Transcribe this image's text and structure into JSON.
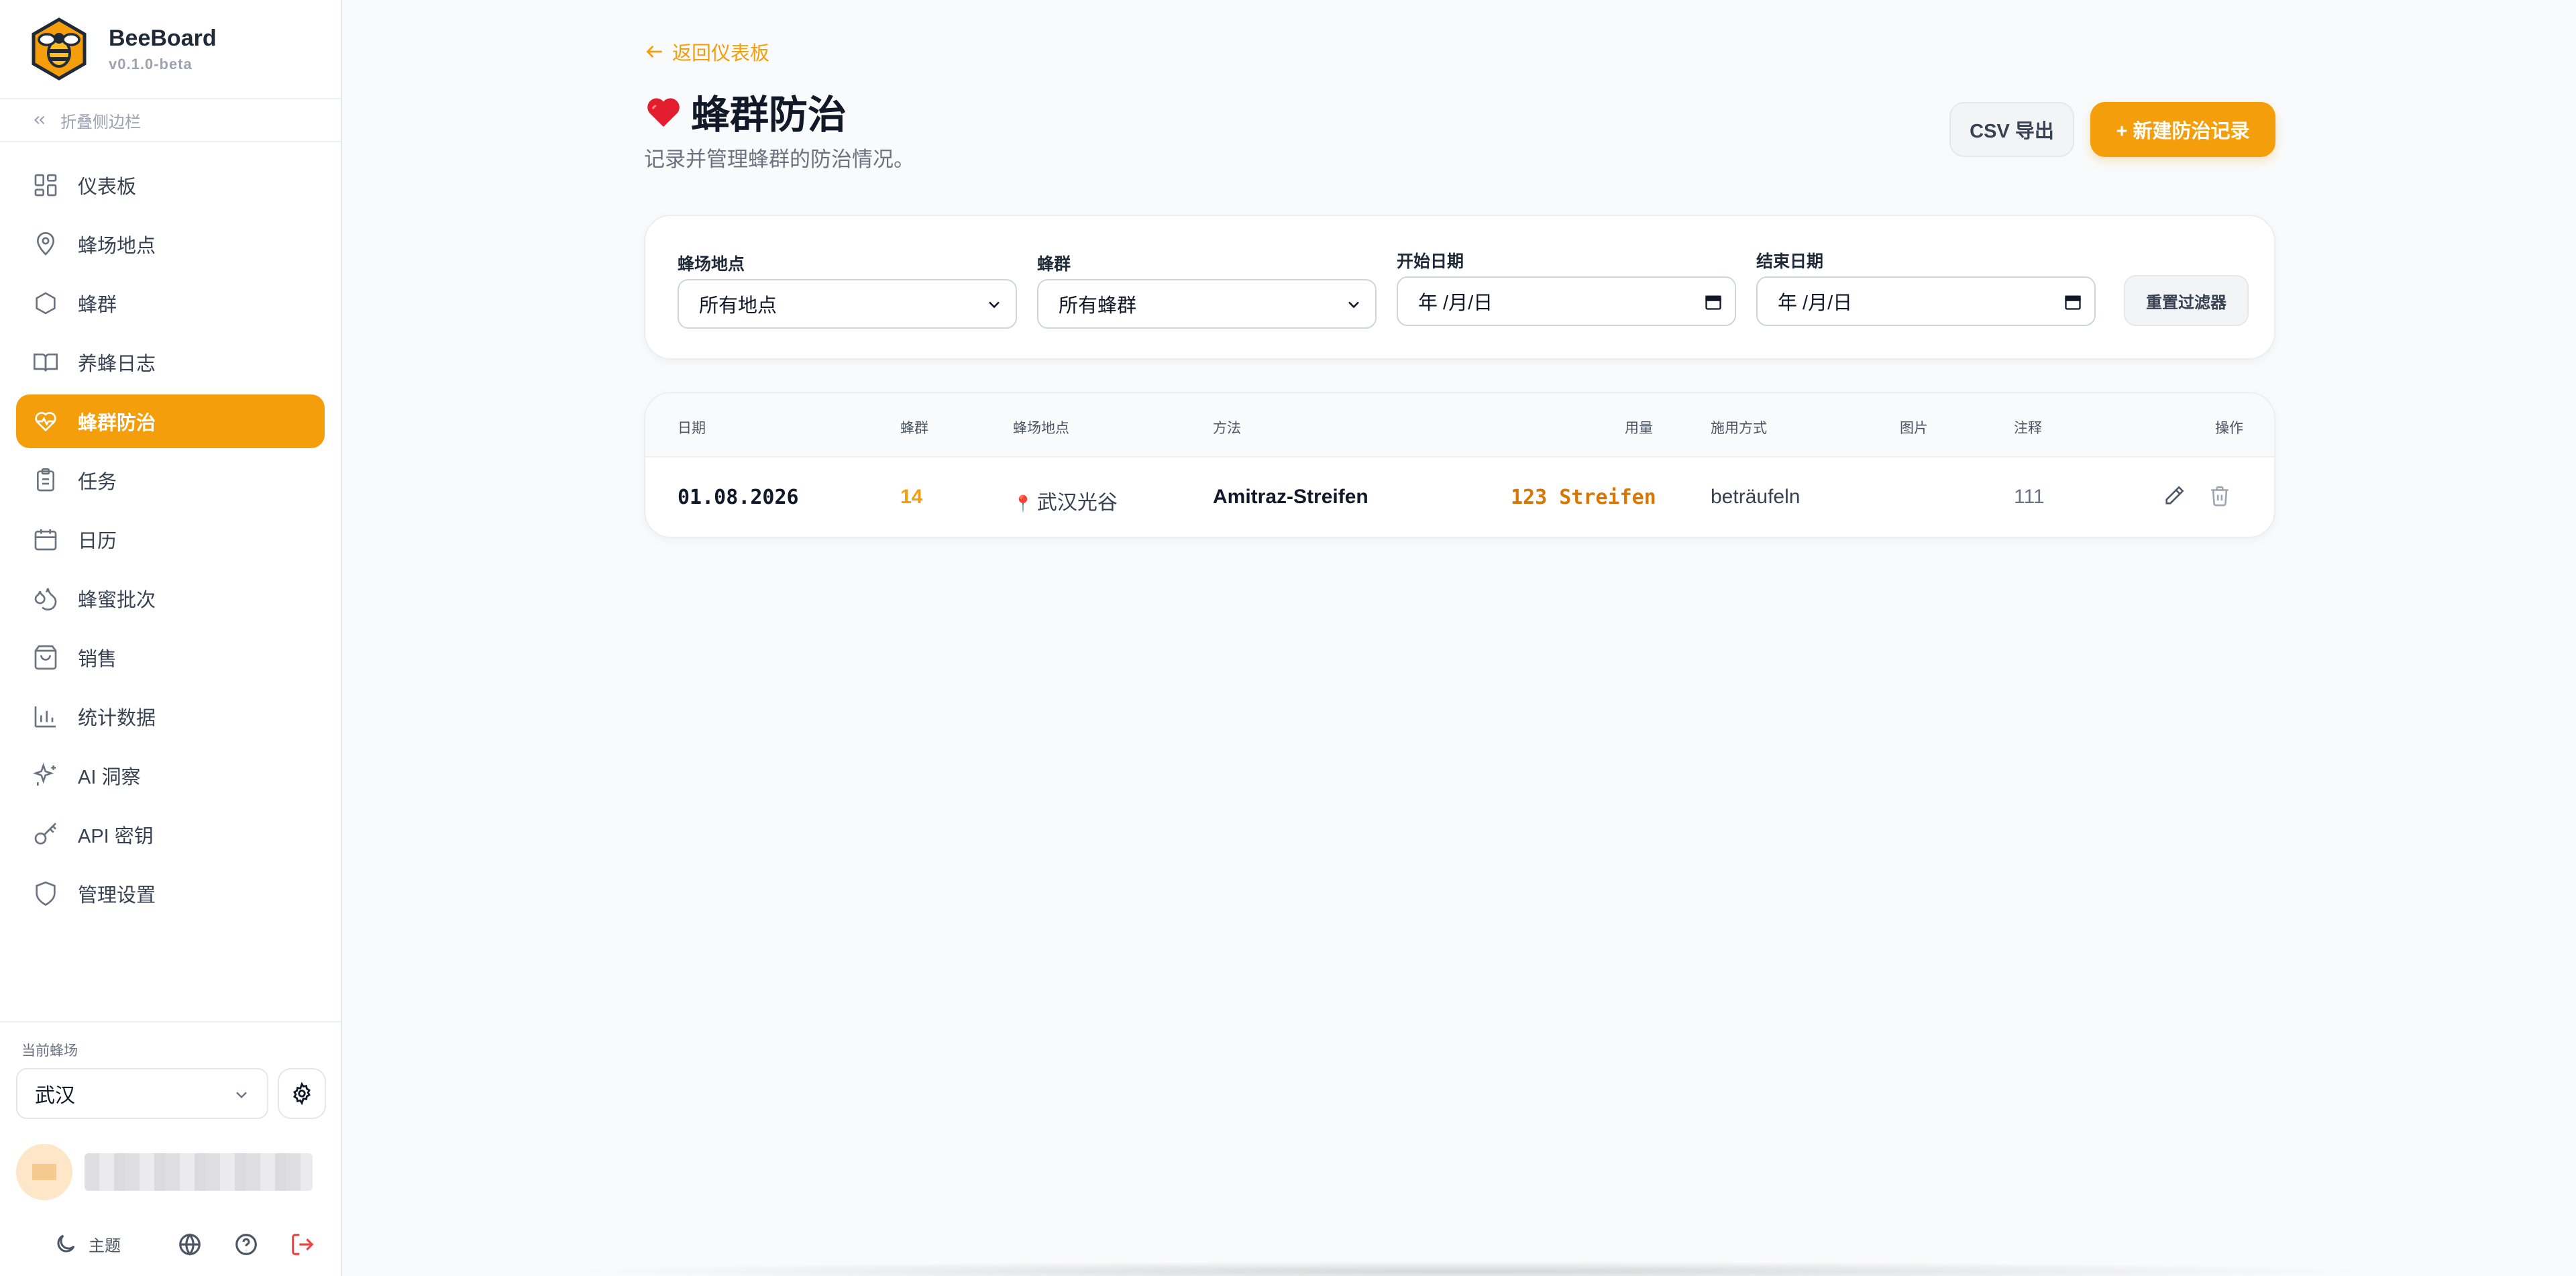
{
  "app": {
    "name": "BeeBoard",
    "version": "v0.1.0-beta"
  },
  "sidebar": {
    "collapse_label": "折叠侧边栏",
    "items": [
      {
        "label": "仪表板",
        "icon": "dashboard-icon",
        "active": false
      },
      {
        "label": "蜂场地点",
        "icon": "map-pin-icon",
        "active": false
      },
      {
        "label": "蜂群",
        "icon": "hexagon-icon",
        "active": false
      },
      {
        "label": "养蜂日志",
        "icon": "book-icon",
        "active": false
      },
      {
        "label": "蜂群防治",
        "icon": "heart-pulse-icon",
        "active": true
      },
      {
        "label": "任务",
        "icon": "clipboard-icon",
        "active": false
      },
      {
        "label": "日历",
        "icon": "calendar-icon",
        "active": false
      },
      {
        "label": "蜂蜜批次",
        "icon": "droplets-icon",
        "active": false
      },
      {
        "label": "销售",
        "icon": "shopping-bag-icon",
        "active": false
      },
      {
        "label": "统计数据",
        "icon": "bar-chart-icon",
        "active": false
      },
      {
        "label": "AI 洞察",
        "icon": "sparkles-icon",
        "active": false
      },
      {
        "label": "API 密钥",
        "icon": "key-icon",
        "active": false
      },
      {
        "label": "管理设置",
        "icon": "shield-icon",
        "active": false
      }
    ],
    "current_apiary_label": "当前蜂场",
    "current_apiary": "武汉",
    "theme_label": "主题"
  },
  "header": {
    "back_label": "返回仪表板",
    "title": "蜂群防治",
    "subtitle": "记录并管理蜂群的防治情况。",
    "csv_label": "CSV 导出",
    "new_label": "+ 新建防治记录"
  },
  "filters": {
    "location_label": "蜂场地点",
    "location_value": "所有地点",
    "colony_label": "蜂群",
    "colony_value": "所有蜂群",
    "start_label": "开始日期",
    "start_value": "年 /月/日",
    "end_label": "结束日期",
    "end_value": "年 /月/日",
    "reset_label": "重置过滤器"
  },
  "table": {
    "headers": [
      "日期",
      "蜂群",
      "蜂场地点",
      "方法",
      "用量",
      "施用方式",
      "图片",
      "注释",
      "操作"
    ],
    "rows": [
      {
        "date": "01.08.2026",
        "colony": "14",
        "location": "武汉光谷",
        "method": "Amitraz-Streifen",
        "dosage": "123 Streifen",
        "application": "beträufeln",
        "image": "",
        "note": "111"
      }
    ]
  },
  "colors": {
    "accent": "#f59e0b",
    "danger": "#ef4444",
    "text": "#111827",
    "muted": "#6b7280"
  }
}
